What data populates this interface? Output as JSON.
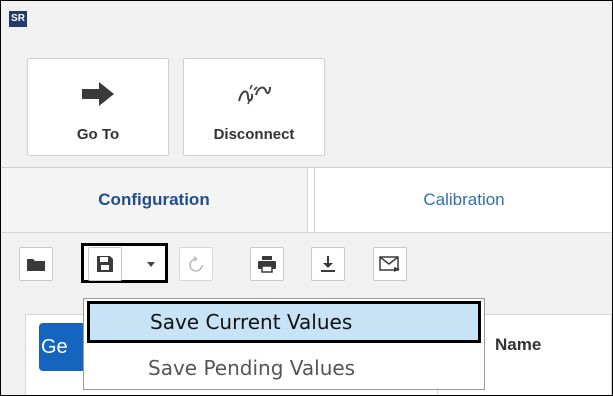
{
  "app": {
    "badge": "SR"
  },
  "ribbon": {
    "goto_label": "Go To",
    "disconnect_label": "Disconnect"
  },
  "tabs": [
    {
      "label": "Configuration",
      "active": true
    },
    {
      "label": "Calibration",
      "active": false
    }
  ],
  "toolbar": {
    "icons": [
      "folder-icon",
      "save-icon",
      "chevron-down-icon",
      "refresh-icon",
      "print-icon",
      "download-icon",
      "email-icon"
    ]
  },
  "dropdown": {
    "items": [
      {
        "label": "Save Current Values",
        "state": "highlighted"
      },
      {
        "label": "Save Pending Values",
        "state": "normal"
      }
    ]
  },
  "content": {
    "group_tab_label": "Ge",
    "column_header": "Name"
  },
  "colors": {
    "accent": "#1565c0",
    "highlight": "#c9e3f6",
    "tab_active_text": "#1f4e8c",
    "tab_text": "#2f6fb6"
  }
}
